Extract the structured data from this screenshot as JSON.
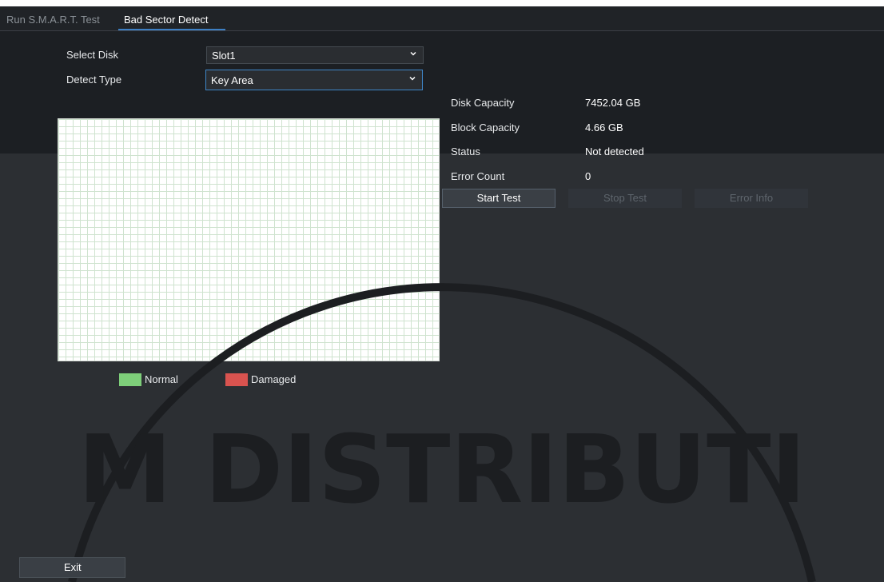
{
  "tabs": [
    {
      "label": "Run S.M.A.R.T. Test",
      "active": false
    },
    {
      "label": "Bad Sector Detect",
      "active": true
    }
  ],
  "form": {
    "select_disk_label": "Select Disk",
    "select_disk_value": "Slot1",
    "detect_type_label": "Detect Type",
    "detect_type_value": "Key Area"
  },
  "info": {
    "disk_capacity_label": "Disk Capacity",
    "disk_capacity_value": "7452.04 GB",
    "block_capacity_label": "Block Capacity",
    "block_capacity_value": "4.66 GB",
    "status_label": "Status",
    "status_value": "Not detected",
    "error_count_label": "Error Count",
    "error_count_value": "0"
  },
  "buttons": {
    "start_test": "Start Test",
    "stop_test": "Stop Test",
    "error_info": "Error Info",
    "exit": "Exit"
  },
  "legend": {
    "normal_label": "Normal",
    "normal_color": "#7ecf7a",
    "damaged_label": "Damaged",
    "damaged_color": "#d9534f"
  },
  "watermark": {
    "text": "M DISTRIBUTI"
  },
  "icons": {
    "dropdown": "chevron-down-icon"
  }
}
